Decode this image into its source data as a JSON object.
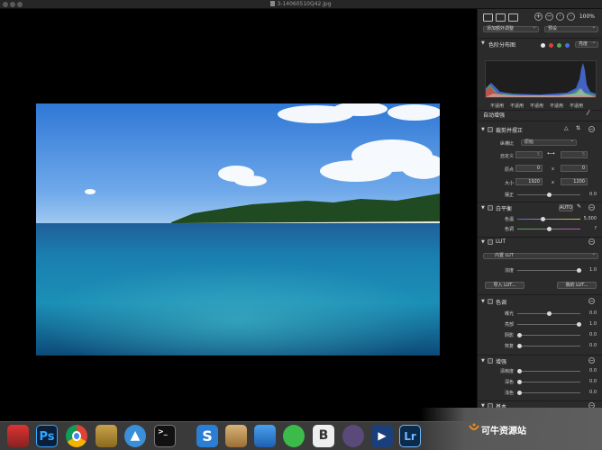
{
  "window": {
    "filename": "3-14060510Q42.jpg"
  },
  "toolbar": {
    "zoom": "100%",
    "preset_left": "添加额外调整",
    "preset_right": "预设"
  },
  "histogram": {
    "title": "色阶分布图",
    "mode": "亮度",
    "na_labels": [
      "不适用",
      "不适用",
      "不适用",
      "不适用",
      "不适用"
    ],
    "channel_colors": [
      "#e8e8e8",
      "#d94040",
      "#4fb04f",
      "#4a6fe0"
    ]
  },
  "auto_enhance": {
    "label": "自动增强"
  },
  "crop": {
    "title": "裁剪并摆正",
    "aspect_label": "纵横比",
    "aspect_value": "原始",
    "custom_label": "自定义",
    "custom_w": "5",
    "custom_h": "5",
    "origin_label": "原点",
    "origin_x": "0",
    "origin_y": "0",
    "size_label": "大小",
    "size_w": "1920",
    "size_h": "1200",
    "straighten_label": "摆正",
    "straighten_value": "0.0",
    "sep": "x"
  },
  "white_balance": {
    "title": "白平衡",
    "auto": "AUTO",
    "temp_label": "色温",
    "temp_value": "5,000",
    "tint_label": "色调",
    "tint_value": "?"
  },
  "lut": {
    "title": "LUT",
    "preset": "内置 LUT",
    "density_label": "浓度",
    "density_value": "1.0",
    "import_btn": "导入 LUT...",
    "mine_btn": "我的 LUT..."
  },
  "tone": {
    "title": "色调",
    "rows": [
      {
        "label": "曝光",
        "value": "0.0"
      },
      {
        "label": "亮部",
        "value": "1.0"
      },
      {
        "label": "阴影",
        "value": "0.0"
      },
      {
        "label": "恢复",
        "value": "0.0"
      }
    ]
  },
  "enhance": {
    "title": "增强",
    "rows": [
      {
        "label": "清晰度",
        "value": "0.0"
      },
      {
        "label": "深色",
        "value": "0.0"
      },
      {
        "label": "浅色",
        "value": "0.0"
      }
    ]
  },
  "basic": {
    "title": "基本"
  },
  "dock": {
    "apps": [
      {
        "name": "photo-booth",
        "label": ""
      },
      {
        "name": "photoshop",
        "label": "Ps"
      },
      {
        "name": "chrome",
        "label": ""
      },
      {
        "name": "notebook",
        "label": ""
      },
      {
        "name": "mountain-app",
        "label": ""
      },
      {
        "name": "terminal",
        "label": ">_"
      },
      {
        "name": "s-app",
        "label": "S"
      },
      {
        "name": "package-app",
        "label": ""
      },
      {
        "name": "xcode",
        "label": ""
      },
      {
        "name": "wechat",
        "label": ""
      },
      {
        "name": "bbedit",
        "label": "B"
      },
      {
        "name": "ninja-app",
        "label": ""
      },
      {
        "name": "play-app",
        "label": ""
      },
      {
        "name": "lightroom",
        "label": "Lr"
      }
    ]
  },
  "watermark": {
    "text": "可牛资源站"
  }
}
